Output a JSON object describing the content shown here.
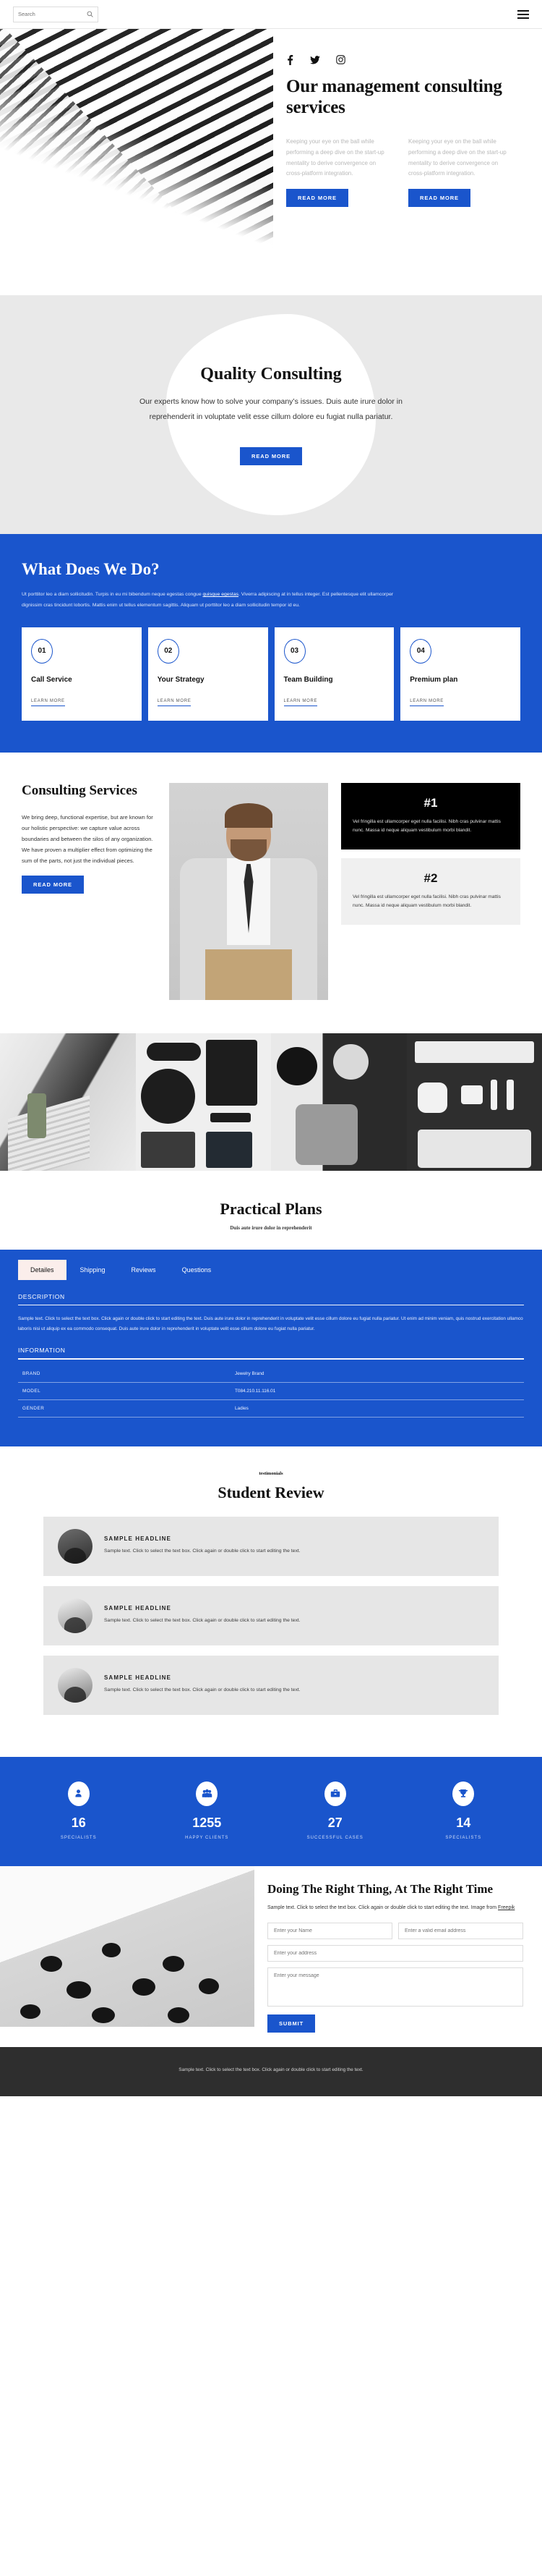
{
  "topbar": {
    "search_placeholder": "Search",
    "search_value": "",
    "search_icon": "search-icon",
    "menu_icon": "hamburger-menu-icon"
  },
  "hero": {
    "socials": [
      {
        "name": "facebook-icon",
        "label": "Facebook"
      },
      {
        "name": "twitter-icon",
        "label": "Twitter"
      },
      {
        "name": "instagram-icon",
        "label": "Instagram"
      }
    ],
    "title": "Our management consulting services",
    "columns": [
      {
        "text": "Keeping your eye on the ball while performing a deep dive on the start-up mentality to derive convergence on cross-platform integration.",
        "button": "READ MORE"
      },
      {
        "text": "Keeping your eye on the ball while performing a deep dive on the start-up mentality to derive convergence on cross-platform integration.",
        "button": "READ MORE"
      }
    ]
  },
  "quality": {
    "title": "Quality Consulting",
    "body": "Our experts know how to solve your company’s issues. Duis aute irure dolor in reprehenderit in voluptate velit esse cillum dolore eu fugiat nulla pariatur.",
    "button": "READ MORE"
  },
  "whatwedo": {
    "title": "What Does We Do?",
    "paragraph_a": "Ut porttitor leo a diam sollicitudin. Turpis in eu mi bibendum neque egestas congue ",
    "paragraph_link": "quisque egestas",
    "paragraph_b": ". Viverra adipiscing at in tellus integer. Est pellentesque elit ullamcorper dignissim cras tincidunt lobortis. Mattis enim ut tellus elementum sagittis. Aliquam ut porttitor leo a diam sollicitudin tempor id eu.",
    "cards": [
      {
        "num": "01",
        "title": "Call Service",
        "link": "LEARN MORE"
      },
      {
        "num": "02",
        "title": "Your Strategy",
        "link": "LEARN MORE"
      },
      {
        "num": "03",
        "title": "Team Building",
        "link": "LEARN MORE"
      },
      {
        "num": "04",
        "title": "Premium plan",
        "link": "LEARN MORE"
      }
    ]
  },
  "consulting": {
    "title": "Consulting Services",
    "body": "We bring deep, functional expertise, but are known for our holistic perspective: we capture value across boundaries and between the silos of any organization. We have proven a multiplier effect from optimizing the sum of the parts, not just the individual pieces.",
    "button": "READ MORE",
    "photo_alt": "smiling-businessman-photo",
    "ranks": [
      {
        "title": "#1",
        "text": "Vel fringilla est ullamcorper eget nulla facilisi. Nibh cras pulvinar mattis nunc. Massa id neque aliquam vestibulum morbi blandit."
      },
      {
        "title": "#2",
        "text": "Vel fringilla est ullamcorper eget nulla facilisi. Nibh cras pulvinar mattis nunc. Massa id neque aliquam vestibulum morbi blandit."
      }
    ]
  },
  "gallery": {
    "items": [
      {
        "alt": "man-on-staircase-photo"
      },
      {
        "alt": "desk-flatlay-devices-photo"
      },
      {
        "alt": "person-at-desk-with-headphones-photo"
      },
      {
        "alt": "keyboard-mouse-laptop-photo"
      }
    ]
  },
  "plans": {
    "title": "Practical Plans",
    "subtitle": "Duis aute irure dolor in reprehenderit",
    "tabs": [
      {
        "label": "Detailes",
        "active": true
      },
      {
        "label": "Shipping",
        "active": false
      },
      {
        "label": "Reviews",
        "active": false
      },
      {
        "label": "Questions",
        "active": false
      }
    ],
    "description_heading": "DESCRIPTION",
    "description": "Sample text. Click to select the text box. Click again or double click to start editing the text. Duis aute irure dolor in reprehenderit in voluptate velit esse cillum dolore eu fugiat nulla pariatur. Ut enim ad minim veniam, quis nostrud exercitation ullamco laboris nisi ut aliquip ex ea commodo consequat. Duis aute irure dolor in reprehenderit in voluptate velit esse cillum dolore eu fugiat nulla pariatur.",
    "information_heading": "INFORMATION",
    "information_rows": [
      {
        "key": "BRAND",
        "value": "Jewelry Brand"
      },
      {
        "key": "MODEL",
        "value": "T084.210.11.116.01"
      },
      {
        "key": "GENDER",
        "value": "Ladies"
      }
    ]
  },
  "testimonials": {
    "eyebrow": "testimonials",
    "title": "Student Review",
    "items": [
      {
        "headline": "SAMPLE HEADLINE",
        "text": "Sample text. Click to select the text box. Click again or double click to start editing the text.",
        "avatar": "woman-portrait-avatar"
      },
      {
        "headline": "SAMPLE HEADLINE",
        "text": "Sample text. Click to select the text box. Click again or double click to start editing the text.",
        "avatar": "photographer-avatar"
      },
      {
        "headline": "SAMPLE HEADLINE",
        "text": "Sample text. Click to select the text box. Click again or double click to start editing the text.",
        "avatar": "man-outdoors-avatar"
      }
    ]
  },
  "stats": [
    {
      "icon": "user-icon",
      "value": "16",
      "label": "SPECIALISTS"
    },
    {
      "icon": "group-icon",
      "value": "1255",
      "label": "HAPPY CLIENTS"
    },
    {
      "icon": "briefcase-icon",
      "value": "27",
      "label": "SUCCESSFUL CASES"
    },
    {
      "icon": "trophy-icon",
      "value": "14",
      "label": "SPECIALISTS"
    }
  ],
  "contact": {
    "image_alt": "abstract-dotted-sculpture-photo",
    "title": "Doing The Right Thing, At The Right Time",
    "lead_a": "Sample text. Click to select the text box. Click again or double click to start editing the text. Image from ",
    "lead_link": "Freepik",
    "name_placeholder": "Enter your Name",
    "email_placeholder": "Enter a valid email address",
    "address_placeholder": "Enter your address",
    "message_placeholder": "Enter your message",
    "submit": "SUBMIT"
  },
  "footer": {
    "text": "Sample text. Click to select the text box. Click again or double click to start editing the text."
  }
}
